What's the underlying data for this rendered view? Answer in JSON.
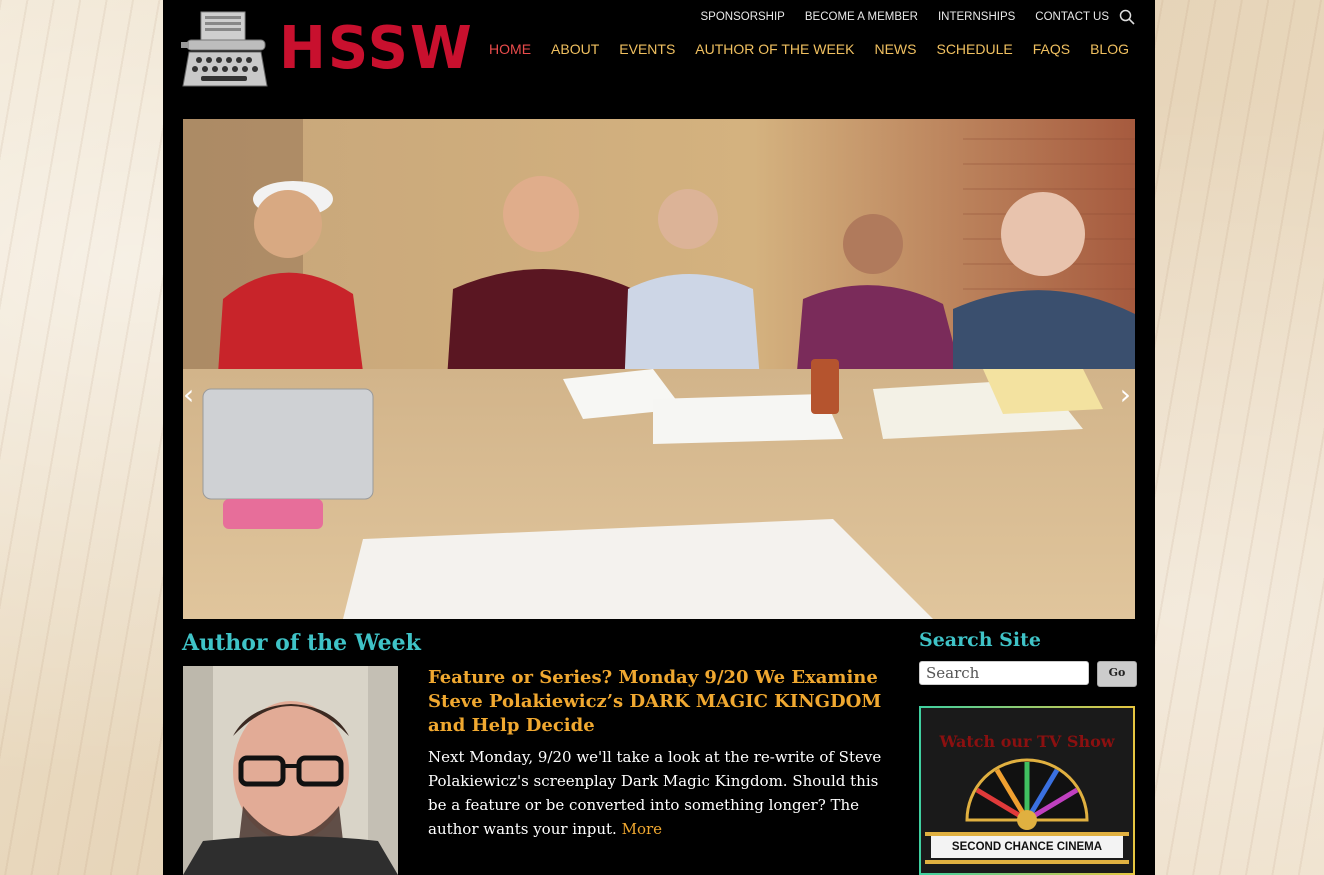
{
  "site": {
    "logo_text": "HSSW",
    "utility_nav": [
      "SPONSORSHIP",
      "BECOME A MEMBER",
      "INTERNSHIPS",
      "CONTACT US"
    ],
    "main_nav": [
      "HOME",
      "ABOUT",
      "EVENTS",
      "AUTHOR OF THE WEEK",
      "NEWS",
      "SCHEDULE",
      "FAQS",
      "BLOG"
    ],
    "active_nav": "HOME",
    "colors": {
      "accent_teal": "#3fc3c7",
      "accent_gold": "#f0a830",
      "nav_gold": "#f0c060",
      "nav_active": "#ea4c4c",
      "logo_red": "#c8102e"
    }
  },
  "author_section": {
    "heading": "Author of the Week",
    "post_title": "Feature or Series? Monday 9/20 We Examine Steve Polakiewicz’s DARK MAGIC KINGDOM and Help Decide",
    "post_body": "Next Monday, 9/20 we'll take a look at the re-write of Steve Polakiewicz's screenplay Dark Magic Kingdom.  Should this be a feature or be converted into something longer? The author wants your input.",
    "more_link": "More"
  },
  "sidebar": {
    "search_heading": "Search Site",
    "search_placeholder": "Search",
    "go_label": "Go",
    "tv_title": "Watch our TV Show",
    "tv_marquee": "SECOND CHANCE CINEMA"
  },
  "icons": {
    "search": "search-icon",
    "prev": "chevron-left-icon",
    "next": "chevron-right-icon",
    "logo": "typewriter-icon"
  }
}
